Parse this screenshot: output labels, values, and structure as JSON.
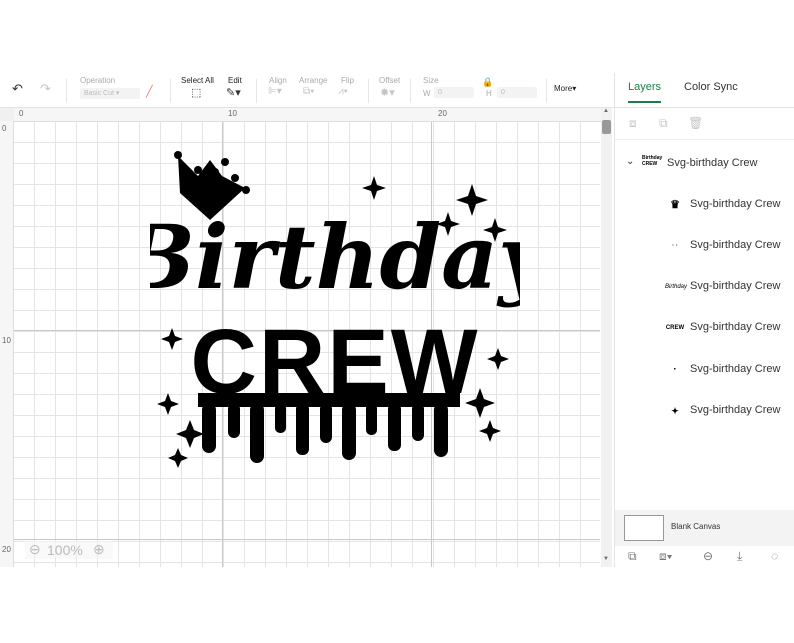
{
  "toolbar": {
    "operation_label": "Operation",
    "operation_value": "Basic Cut",
    "select_all": "Select All",
    "edit": "Edit",
    "align": "Align",
    "arrange": "Arrange",
    "flip": "Flip",
    "offset": "Offset",
    "size": "Size",
    "w_label": "W",
    "w_value": "0",
    "h_label": "H",
    "h_value": "0",
    "more": "More"
  },
  "panel": {
    "tabs": [
      "Layers",
      "Color Sync"
    ],
    "group_label": "Svg-birthday Crew",
    "group_thumb": "Birthday CREW",
    "layers": [
      {
        "label": "Svg-birthday Crew",
        "thumb": "♛"
      },
      {
        "label": "Svg-birthday Crew",
        "thumb": "· ·"
      },
      {
        "label": "Svg-birthday Crew",
        "thumb": "Birthday"
      },
      {
        "label": "Svg-birthday Crew",
        "thumb": "CREW"
      },
      {
        "label": "Svg-birthday Crew",
        "thumb": "·"
      },
      {
        "label": "Svg-birthday Crew",
        "thumb": "✦"
      }
    ],
    "blank_canvas": "Blank Canvas"
  },
  "canvas": {
    "ruler_top": [
      "0",
      "10",
      "20"
    ],
    "ruler_left": [
      "0",
      "10",
      "20"
    ],
    "zoom": "100%",
    "design_line1": "Birthday",
    "design_line2": "CREW"
  }
}
